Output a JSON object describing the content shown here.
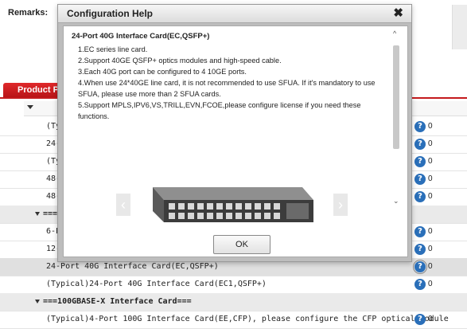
{
  "remarks_label": "Remarks:",
  "tab_label": "Product Pa",
  "rows": [
    {
      "text": "(Typica",
      "count": "0"
    },
    {
      "text": "24-P",
      "count": "0"
    },
    {
      "text": "(Typ",
      "count": "0"
    },
    {
      "text": "48-P",
      "count": "0"
    },
    {
      "text": "48-P",
      "count": "0"
    },
    {
      "text": "===",
      "count": ""
    },
    {
      "text": "6-Po",
      "count": "0"
    },
    {
      "text": "12-P",
      "count": "0"
    },
    {
      "text": "24-Port 40G Interface Card(EC,QSFP+)",
      "count": "0"
    },
    {
      "text": "(Typical)24-Port 40G Interface Card(EC1,QSFP+)",
      "count": "0"
    },
    {
      "text": "===100GBASE-X Interface Card===",
      "count": ""
    },
    {
      "text": "(Typical)4-Port 100G Interface Card(EE,CFP), please configure the CFP optical module",
      "count": "0"
    }
  ],
  "modal": {
    "title": "Configuration Help",
    "close_symbol": "✖",
    "card_title": "24-Port 40G Interface Card(EC,QSFP+)",
    "lines": [
      "1.EC series line card.",
      "2.Support 40GE QSFP+ optics modules and high-speed cable.",
      "3.Each 40G port can be configured to 4 10GE ports.",
      "4.When use 24*40GE line card, it is not recommended to use SFUA. If it's mandatory to use SFUA, please use more than 2 SFUA cards.",
      "5.Support MPLS,IPV6,VS,TRILL,EVN,FCOE,please configure license if you need these functions."
    ],
    "ok_label": "OK"
  },
  "icons": {
    "help": "question-circle-icon",
    "close": "close-icon",
    "prev": "chevron-left-icon",
    "next": "chevron-right-icon"
  },
  "colors": {
    "accent_red": "#c41a1d",
    "help_blue": "#2a6fb9"
  }
}
